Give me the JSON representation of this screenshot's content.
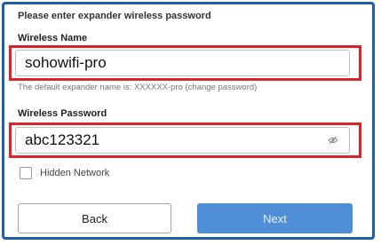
{
  "form": {
    "heading": "Please enter expander wireless password",
    "wireless_name": {
      "label": "Wireless Name",
      "value": "sohowifi-pro",
      "hint": "The default expander name is: XXXXXX-pro (change password)"
    },
    "wireless_password": {
      "label": "Wireless Password",
      "value": "abc123321",
      "toggle_icon": "eye-toggle-icon"
    },
    "hidden_network": {
      "label": "Hidden Network",
      "checked": false
    },
    "buttons": {
      "back": "Back",
      "next": "Next"
    }
  },
  "colors": {
    "frame_border": "#1f5fa8",
    "highlight": "#d9252b",
    "primary_button": "#4f8fd8"
  }
}
